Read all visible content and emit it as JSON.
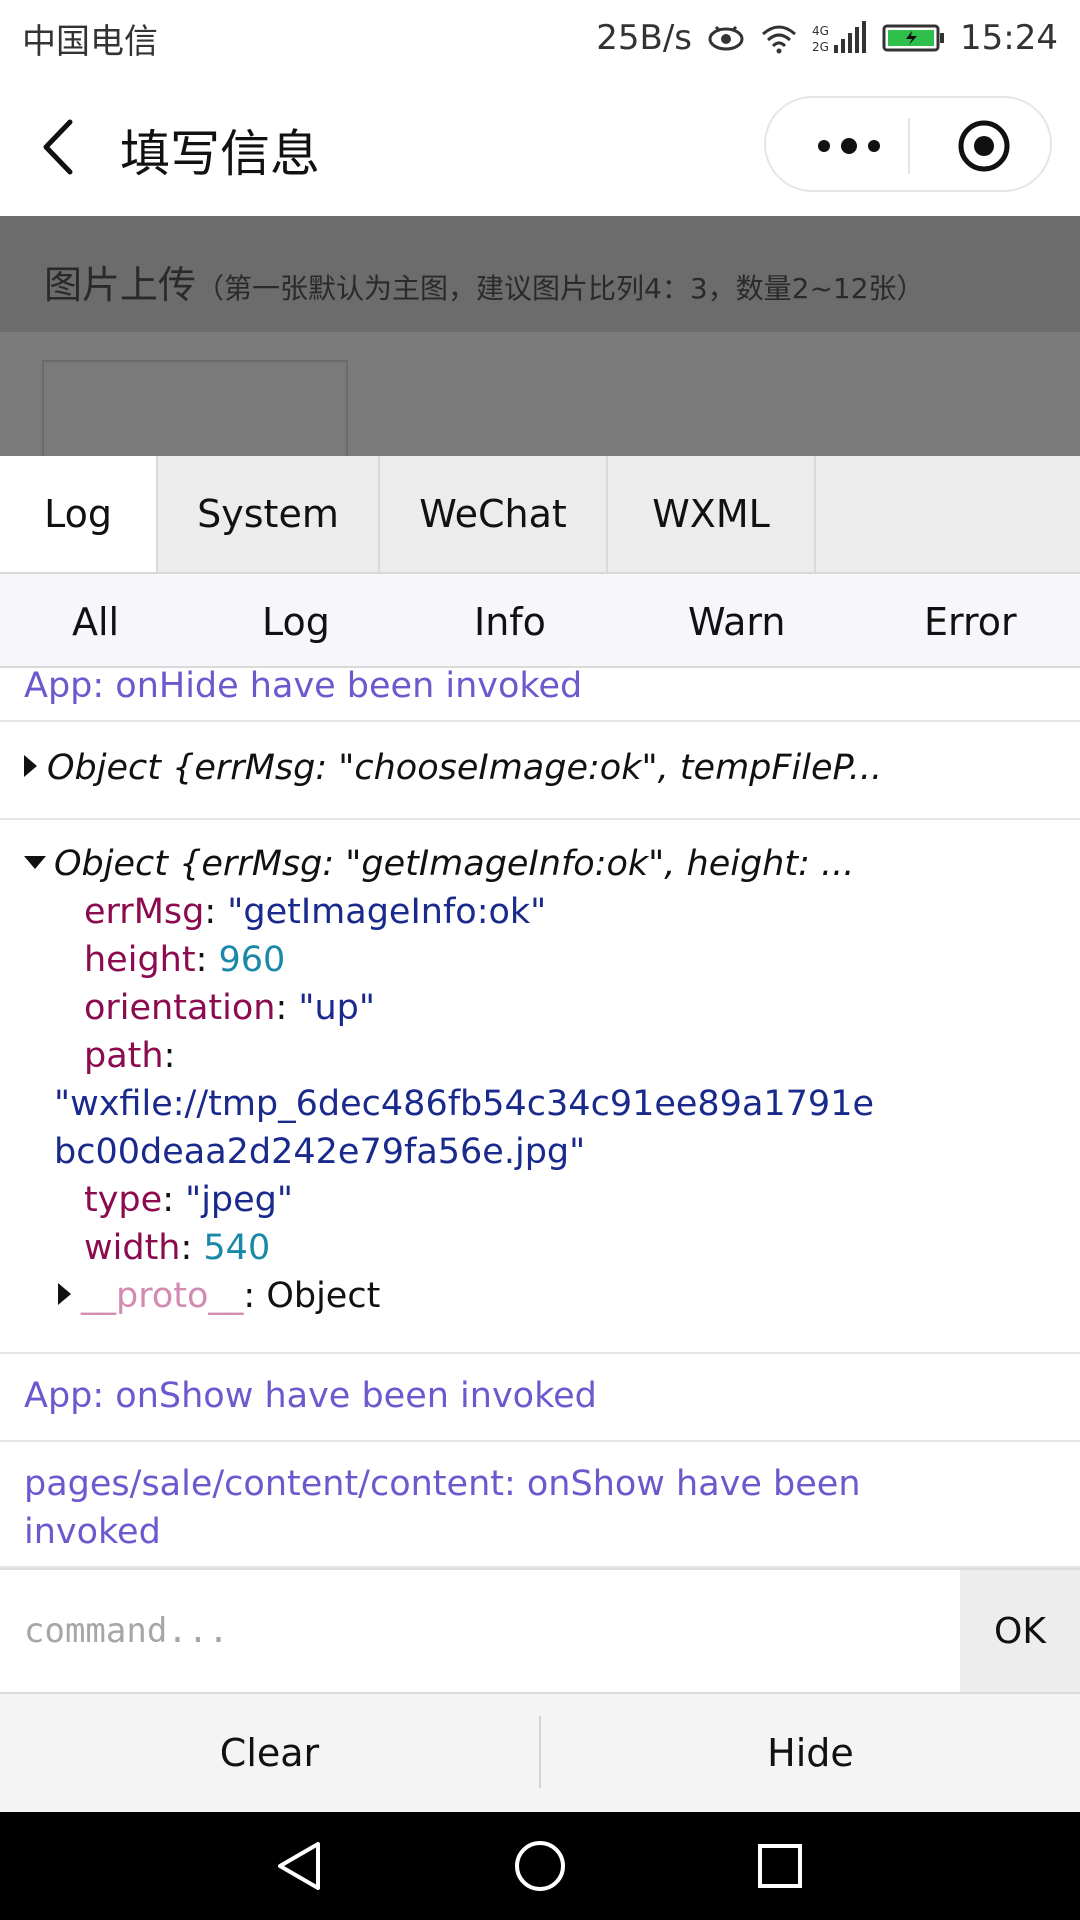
{
  "status_bar": {
    "carrier": "中国电信",
    "net_speed": "25B/s",
    "network_badge": "4G 2G",
    "time": "15:24",
    "icons": [
      "eye-icon",
      "wifi-icon",
      "signal-icon",
      "battery-charging-icon"
    ],
    "battery_color": "#2fc04b"
  },
  "nav": {
    "title": "填写信息",
    "back_icon": "chevron-left-icon",
    "more_icon": "more-dots-icon",
    "close_icon": "target-circle-icon"
  },
  "page": {
    "upload_title": "图片上传",
    "upload_hint": "（第一张默认为主图，建议图片比列4：3，数量2~12张）"
  },
  "console": {
    "tabs": [
      "Log",
      "System",
      "WeChat",
      "WXML"
    ],
    "active_tab": "Log",
    "filters": [
      "All",
      "Log",
      "Info",
      "Warn",
      "Error"
    ],
    "logs": {
      "hide_line": "App: onHide have been invoked",
      "object_collapsed": "Object {errMsg: \"chooseImage:ok\", tempFileP...",
      "object_expanded": {
        "summary": "Object {errMsg: \"getImageInfo:ok\", height: ...",
        "errMsg_key": "errMsg",
        "errMsg_val": "\"getImageInfo:ok\"",
        "height_key": "height",
        "height_val": "960",
        "orientation_key": "orientation",
        "orientation_val": "\"up\"",
        "path_key": "path",
        "path_val_line1": "\"wxfile://tmp_6dec486fb54c34c91ee89a1791e",
        "path_val_line2": "bc00deaa2d242e79fa56e.jpg\"",
        "type_key": "type",
        "type_val": "\"jpeg\"",
        "width_key": "width",
        "width_val": "540",
        "proto_key": "__proto__",
        "proto_val": "Object"
      },
      "show_line": "App: onShow have been invoked",
      "page_show_line1": "pages/sale/content/content: onShow have been",
      "page_show_line2": "invoked"
    },
    "command_placeholder": "command...",
    "ok_label": "OK",
    "clear_label": "Clear",
    "hide_label": "Hide"
  },
  "android_nav": [
    "back-triangle-icon",
    "home-circle-icon",
    "recents-square-icon"
  ]
}
